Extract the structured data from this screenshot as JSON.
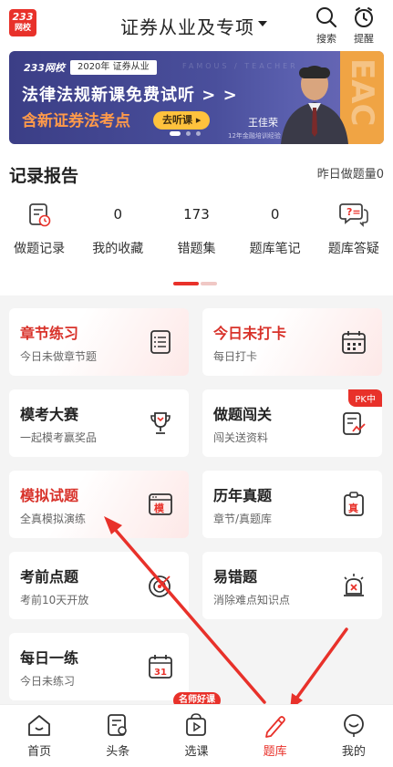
{
  "header": {
    "logo_line1": "233",
    "logo_line2": "网校",
    "exam_title": "证券从业及专项",
    "search_label": "搜索",
    "remind_label": "提醒"
  },
  "banner": {
    "brand": "233网校",
    "year_tag": "2020年 证券从业",
    "ghost_text": "FAMOUS / TEACHER",
    "headline": "法律法规新课免费试听 > >",
    "subline": "含新证券法考点",
    "listen_button": "去听课 ▸",
    "teacher_name": "王佳荣",
    "teacher_desc": "12年金融培训经验",
    "side_text": "EAC",
    "slides_total": 3,
    "slide_active": 1
  },
  "records": {
    "title": "记录报告",
    "yesterday": "昨日做题量0",
    "items": [
      {
        "label": "做题记录",
        "value": "",
        "icon": "clipboard-clock-icon"
      },
      {
        "label": "我的收藏",
        "value": "0"
      },
      {
        "label": "错题集",
        "value": "173"
      },
      {
        "label": "题库笔记",
        "value": "0"
      },
      {
        "label": "题库答疑",
        "value": "",
        "icon": "chat-question-icon"
      }
    ]
  },
  "cards": [
    {
      "title": "章节练习",
      "subtitle": "今日未做章节题",
      "icon": "list-document-icon"
    },
    {
      "title": "今日未打卡",
      "subtitle": "每日打卡",
      "icon": "calendar-icon"
    },
    {
      "title": "模考大赛",
      "subtitle": "一起模考赢奖品",
      "icon": "trophy-icon"
    },
    {
      "title": "做题闯关",
      "subtitle": "闯关送资料",
      "icon": "document-chart-icon",
      "badge": "PK中"
    },
    {
      "title": "模拟试题",
      "subtitle": "全真模拟演练",
      "icon": "mock-window-icon",
      "icon_text": "模"
    },
    {
      "title": "历年真题",
      "subtitle": "章节/真题库",
      "icon": "real-exam-icon",
      "icon_text": "真"
    },
    {
      "title": "考前点题",
      "subtitle": "考前10天开放",
      "icon": "target-icon"
    },
    {
      "title": "易错题",
      "subtitle": "消除难点知识点",
      "icon": "alarm-icon"
    },
    {
      "title": "每日一练",
      "subtitle": "今日未练习",
      "icon": "calendar-31-icon",
      "icon_text": "31"
    }
  ],
  "tabs": [
    {
      "label": "首页",
      "icon": "home-icon"
    },
    {
      "label": "头条",
      "icon": "news-icon"
    },
    {
      "label": "选课",
      "icon": "play-bag-icon"
    },
    {
      "label": "题库",
      "icon": "pen-icon",
      "active": true
    },
    {
      "label": "我的",
      "icon": "smile-icon"
    }
  ],
  "tab_badge": "名师好课",
  "colors": {
    "accent": "#e8312a",
    "banner_bg": "#3b3e86",
    "banner_orange": "#f0a444",
    "card_highlight": "#fde8e7",
    "grid_bg": "#f4f4f4"
  }
}
